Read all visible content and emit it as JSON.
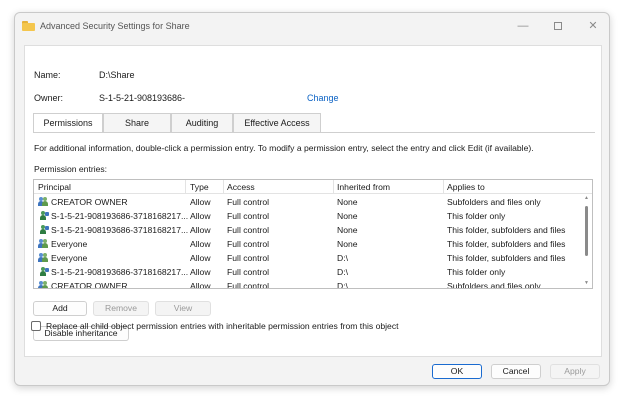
{
  "window": {
    "title": "Advanced Security Settings for Share",
    "controls": {
      "minimize": "—",
      "close": "✕"
    }
  },
  "info": {
    "name_label": "Name:",
    "name_value": "D:\\Share",
    "owner_label": "Owner:",
    "owner_value": "S-1-5-21-908193686-",
    "change_link": "Change"
  },
  "tabs": [
    {
      "label": "Permissions",
      "active": true
    },
    {
      "label": "Share",
      "active": false
    },
    {
      "label": "Auditing",
      "active": false
    },
    {
      "label": "Effective Access",
      "active": false
    }
  ],
  "help_text": "For additional information, double-click a permission entry. To modify a permission entry, select the entry and click Edit (if available).",
  "entries_label": "Permission entries:",
  "table": {
    "headers": [
      "Principal",
      "Type",
      "Access",
      "Inherited from",
      "Applies to"
    ],
    "rows": [
      {
        "principal": "CREATOR OWNER",
        "type": "Allow",
        "access": "Full control",
        "inherited": "None",
        "applies": "Subfolders and files only",
        "icon": "group-icon"
      },
      {
        "principal": "S-1-5-21-908193686-3718168217...",
        "type": "Allow",
        "access": "Full control",
        "inherited": "None",
        "applies": "This folder only",
        "icon": "user-icon"
      },
      {
        "principal": "S-1-5-21-908193686-3718168217...",
        "type": "Allow",
        "access": "Full control",
        "inherited": "None",
        "applies": "This folder, subfolders and files",
        "icon": "user-icon"
      },
      {
        "principal": "Everyone",
        "type": "Allow",
        "access": "Full control",
        "inherited": "None",
        "applies": "This folder, subfolders and files",
        "icon": "group-icon"
      },
      {
        "principal": "Everyone",
        "type": "Allow",
        "access": "Full control",
        "inherited": "D:\\",
        "applies": "This folder, subfolders and files",
        "icon": "group-icon"
      },
      {
        "principal": "S-1-5-21-908193686-3718168217...",
        "type": "Allow",
        "access": "Full control",
        "inherited": "D:\\",
        "applies": "This folder only",
        "icon": "user-icon"
      },
      {
        "principal": "CREATOR OWNER",
        "type": "Allow",
        "access": "Full control",
        "inherited": "D:\\",
        "applies": "Subfolders and files only",
        "icon": "group-icon"
      }
    ]
  },
  "buttons": {
    "add": "Add",
    "remove": "Remove",
    "view": "View",
    "disable_inheritance": "Disable inheritance",
    "ok": "OK",
    "cancel": "Cancel",
    "apply": "Apply"
  },
  "replace_checkbox": {
    "label": "Replace all child object permission entries with inheritable permission entries from this object",
    "checked": false
  }
}
